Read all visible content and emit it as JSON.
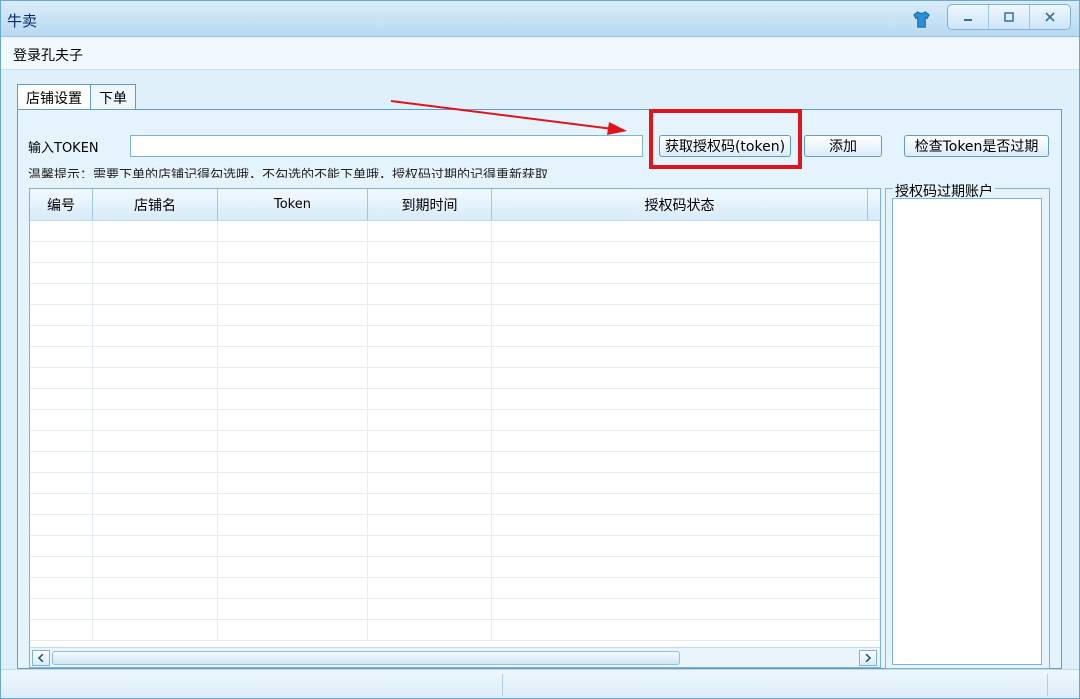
{
  "window": {
    "title": "牛卖"
  },
  "menu": {
    "items": [
      "登录孔夫子"
    ]
  },
  "tabs": [
    {
      "label": "店铺设置",
      "active": true
    },
    {
      "label": "下单",
      "active": false
    }
  ],
  "token": {
    "label": "输入TOKEN",
    "value": "",
    "buttons": {
      "get": "获取授权码(token)",
      "add": "添加",
      "check": "检查Token是否过期"
    }
  },
  "hint": "温馨提示：需要下单的店铺记得勾选哦，不勾选的不能下单哦，授权码过期的记得重新获取",
  "table": {
    "columns": [
      "编号",
      "店铺名",
      "Token",
      "到期时间",
      "授权码状态"
    ],
    "rows": []
  },
  "expired": {
    "title": "授权码过期账户",
    "items": []
  },
  "colors": {
    "highlight": "#e0141b",
    "accent": "#5f9ccc"
  }
}
